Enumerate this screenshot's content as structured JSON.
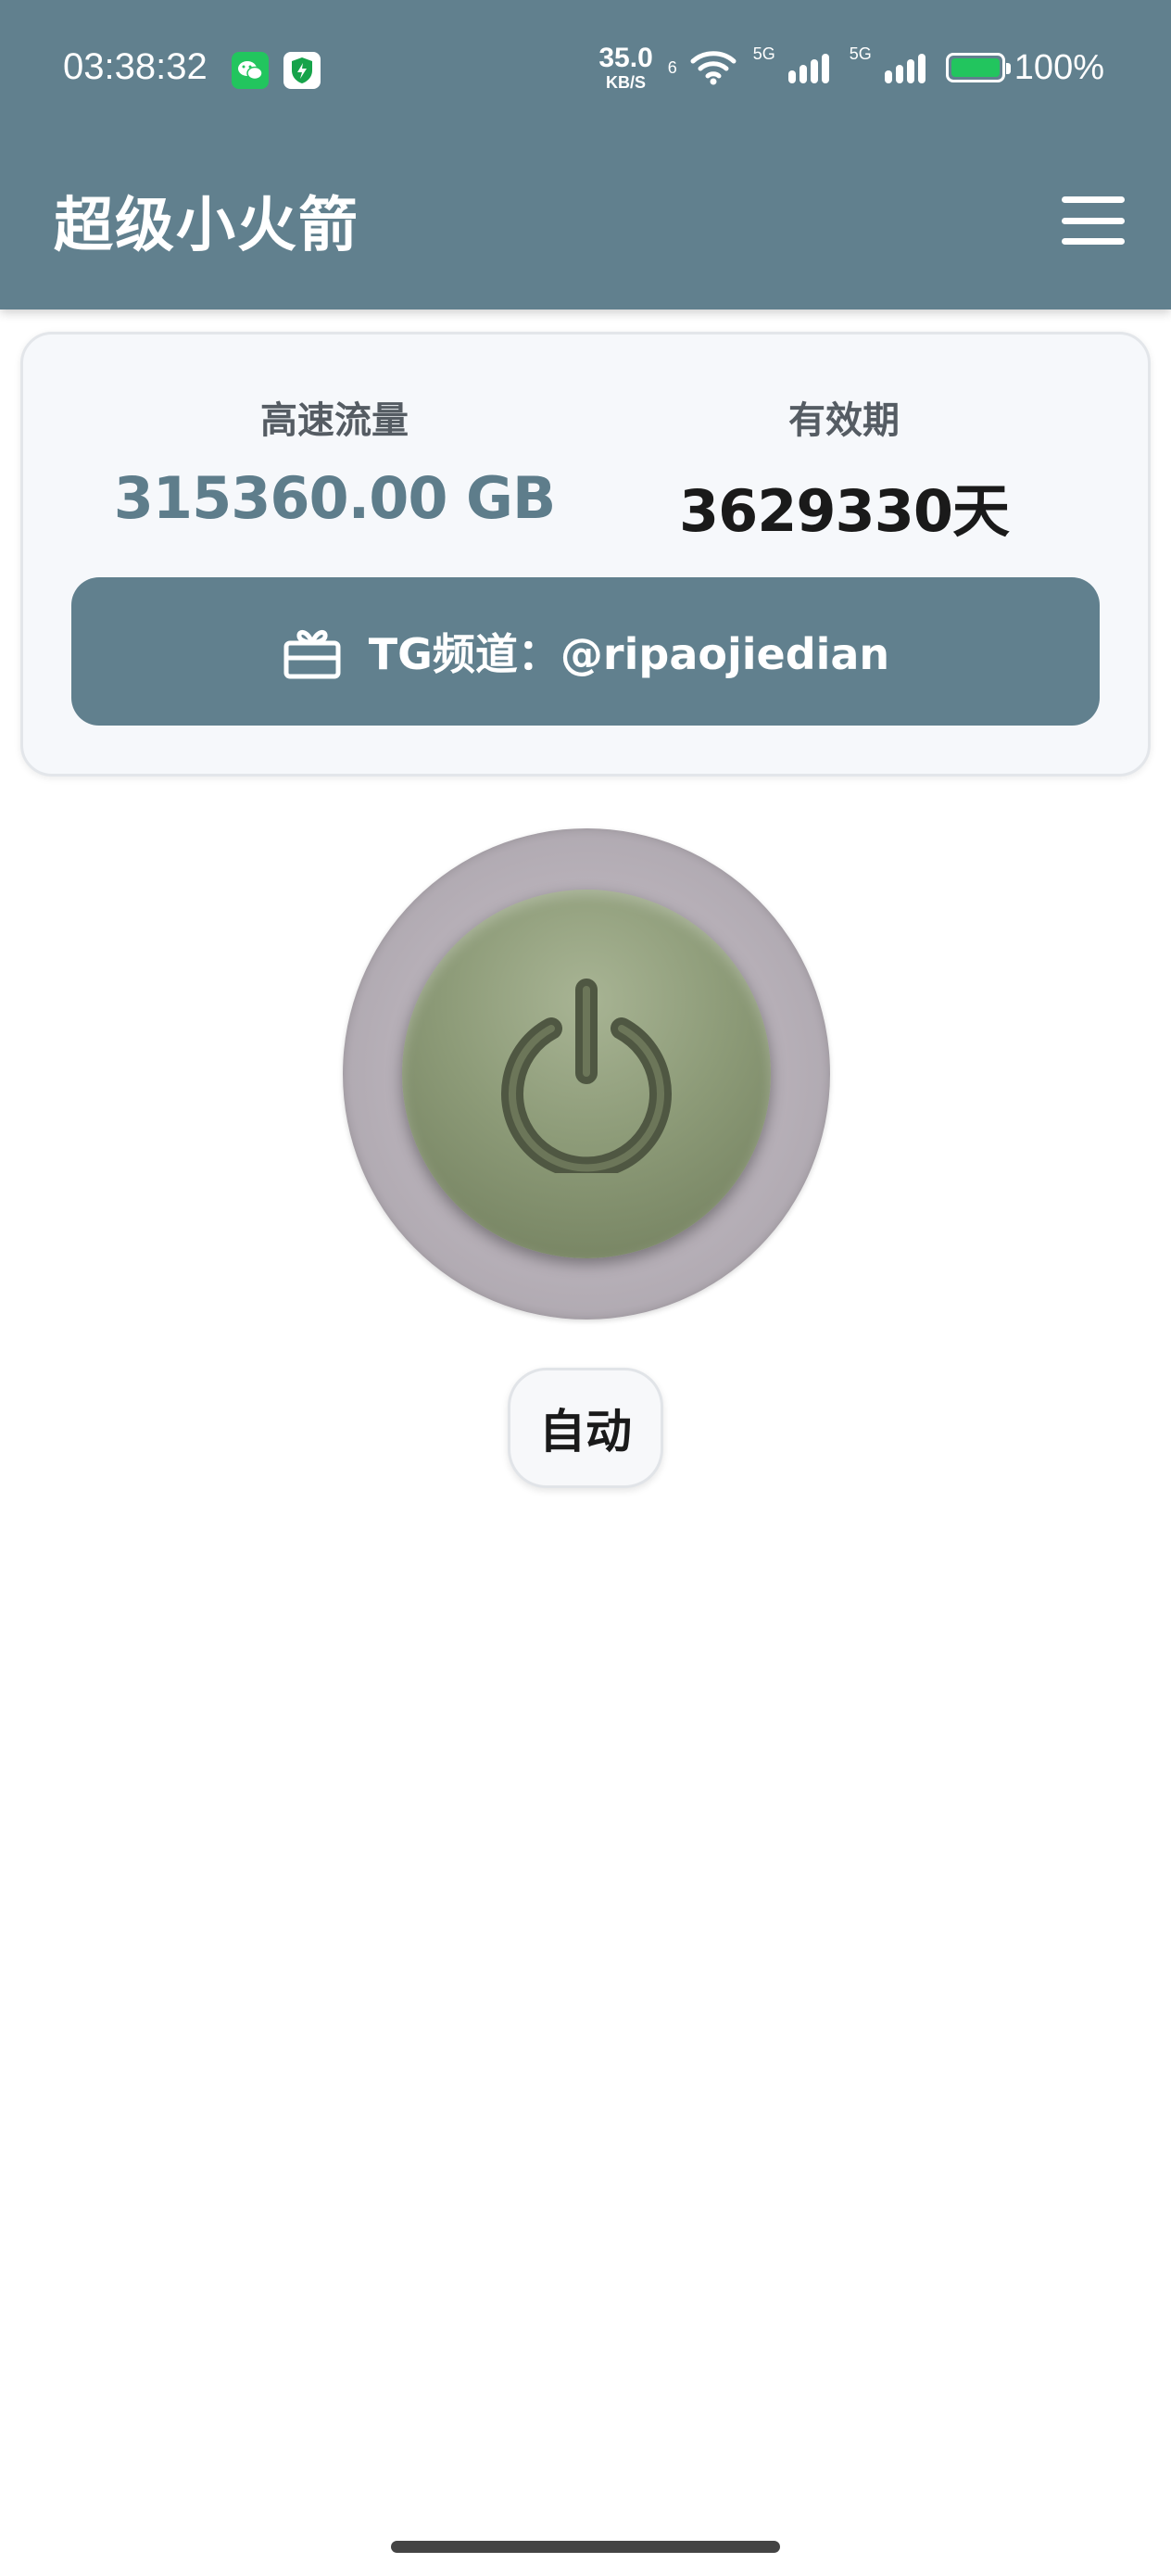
{
  "status_bar": {
    "time": "03:38:32",
    "network_speed_value": "35.0",
    "network_speed_unit": "KB/S",
    "wifi_label": "6",
    "sim1_label": "5G",
    "sim2_label": "5G",
    "battery_level": 1.0,
    "battery_text": "100%",
    "icons": [
      "wechat-icon",
      "security-shield-icon",
      "wifi-icon",
      "signal-icon",
      "battery-charging-icon"
    ]
  },
  "app_bar": {
    "title": "超级小火箭",
    "menu_icon": "hamburger-menu-icon"
  },
  "info_card": {
    "traffic_label": "高速流量",
    "traffic_value": "315360.00 GB",
    "validity_label": "有效期",
    "validity_value": "3629330天",
    "tg_button_label": "TG频道：@ripaojiedian",
    "tg_icon": "gift-icon"
  },
  "power": {
    "icon": "power-icon"
  },
  "mode": {
    "label": "自动"
  },
  "colors": {
    "primary": "#61808e",
    "traffic_value": "#5e7d8b",
    "power_button": "#8d9b78",
    "power_ring": "#b7b0b8"
  }
}
